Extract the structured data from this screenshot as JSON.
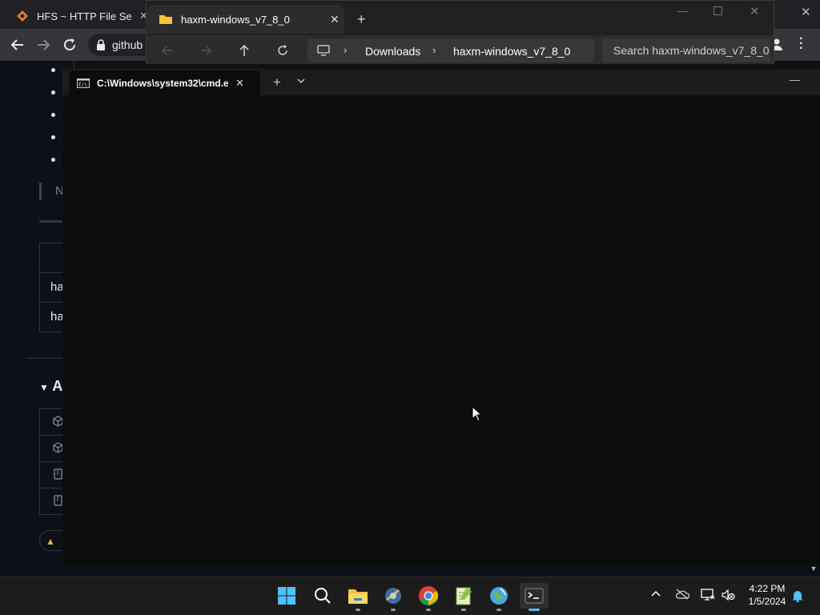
{
  "chrome": {
    "tab_title": "HFS ~ HTTP File Serve",
    "omnibox_text": "github",
    "page_fragments": [
      "N",
      "ha",
      "ha",
      "A"
    ]
  },
  "explorer": {
    "tab_title": "haxm-windows_v7_8_0",
    "breadcrumb": [
      "Downloads",
      "haxm-windows_v7_8_0"
    ],
    "search_placeholder": "Search haxm-windows_v7_8_0"
  },
  "terminal": {
    "tab_title": "C:\\Windows\\system32\\cmd.e:"
  },
  "taskbar": {
    "time": "4:22 PM",
    "date": "1/5/2024"
  },
  "colors": {
    "accent": "#4cc2ff",
    "folder": "#f3c43c",
    "hfs_brand": "#e8792b"
  }
}
